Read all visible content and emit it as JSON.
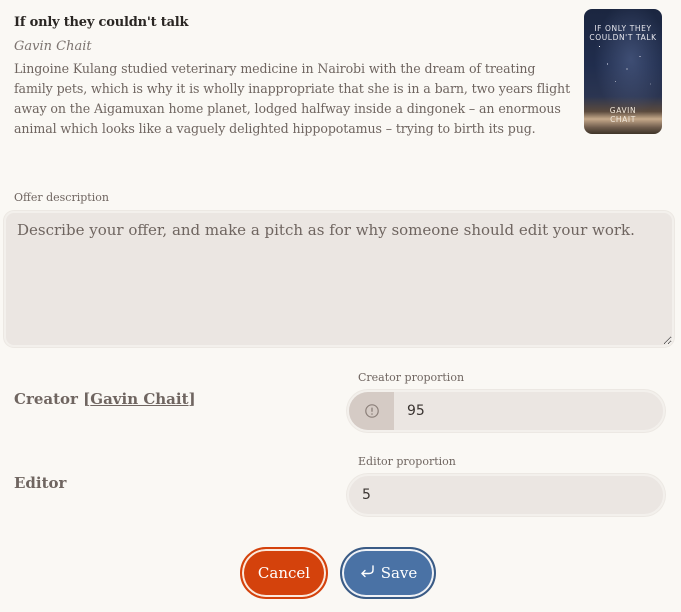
{
  "book": {
    "title": "If only they couldn't talk",
    "author": "Gavin Chait",
    "description": "Lingoine Kulang studied veterinary medicine in Nairobi with the dream of treating family pets, which is why it is wholly inappropriate that she is in a barn, two years flight away on the Aigamuxan home planet, lodged halfway inside a dingonek – an enormous animal which looks like a vaguely delighted hippopotamus – trying to birth its pug.",
    "cover": {
      "title_line1": "IF ONLY THEY",
      "title_line2": "COULDN'T TALK",
      "author_line1": "GAVIN",
      "author_line2": "CHAIT"
    }
  },
  "offer": {
    "label": "Offer description",
    "placeholder": "Describe your offer, and make a pitch as for why someone should edit your work.",
    "value": ""
  },
  "creator": {
    "label_prefix": "Creator [",
    "name": "Gavin Chait",
    "label_suffix": "]",
    "proportion_label": "Creator proportion",
    "proportion_value": "95",
    "icon": "exclamation-circle-icon"
  },
  "editor": {
    "label": "Editor",
    "proportion_label": "Editor proportion",
    "proportion_value": "5"
  },
  "actions": {
    "cancel_label": "Cancel",
    "save_label": "Save",
    "save_icon": "return-arrow-icon"
  },
  "colors": {
    "background": "#faf8f4",
    "input_bg": "#ebe6e2",
    "addon_bg": "#d5cbc5",
    "cancel": "#d4420c",
    "save": "#4a72a5",
    "text": "#6f6560"
  }
}
